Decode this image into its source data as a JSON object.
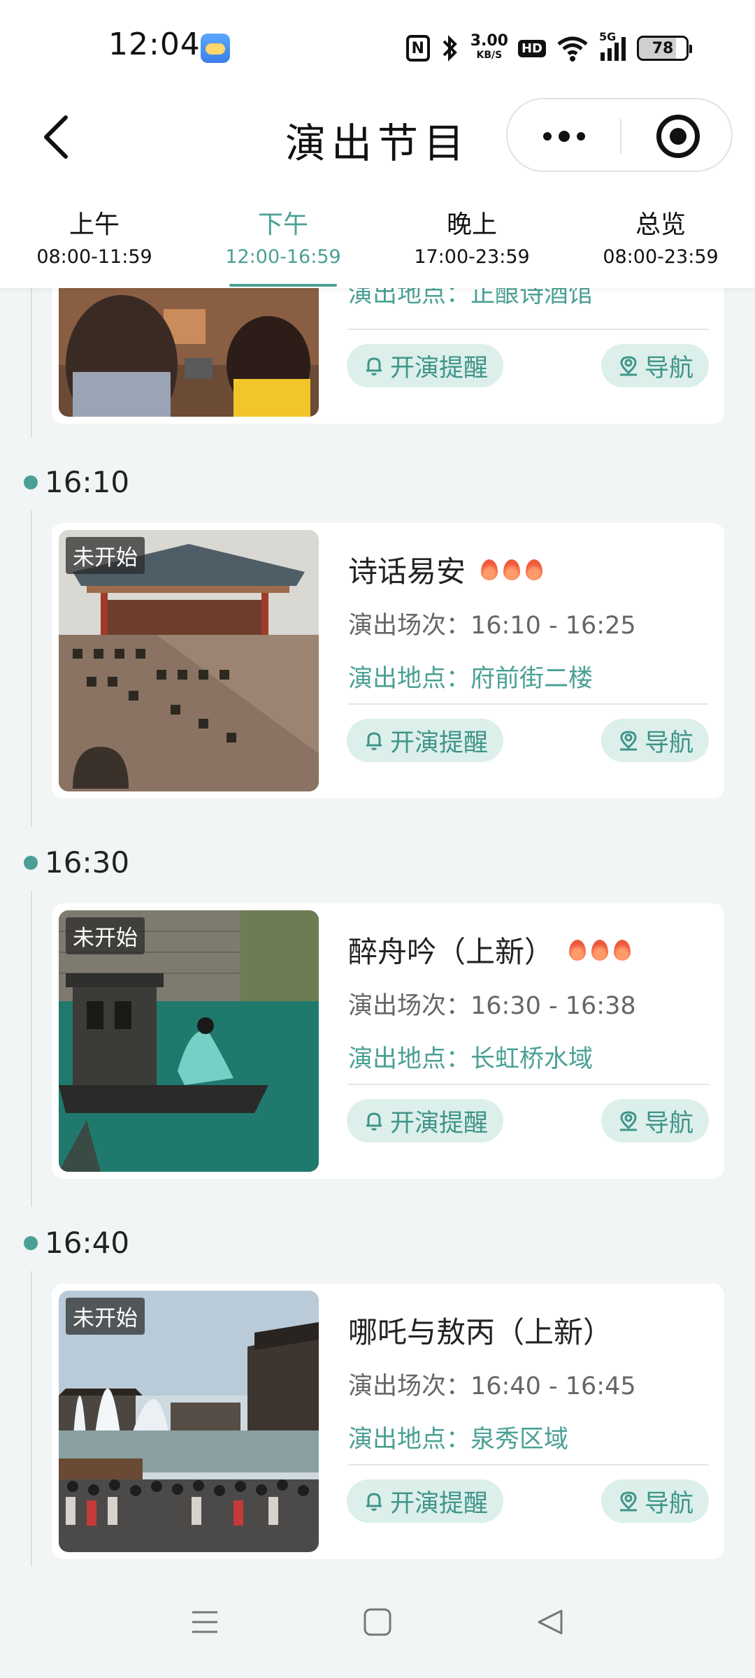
{
  "status_bar": {
    "time": "12:04",
    "net_speed_value": "3.00",
    "net_speed_unit": "KB/S",
    "hd_label": "HD",
    "signal_label": "5G",
    "battery": "78"
  },
  "header": {
    "title": "演出节目"
  },
  "tabs": [
    {
      "name": "上午",
      "time": "08:00-11:59"
    },
    {
      "name": "下午",
      "time": "12:00-16:59"
    },
    {
      "name": "晚上",
      "time": "17:00-23:59"
    },
    {
      "name": "总览",
      "time": "08:00-23:59"
    }
  ],
  "active_tab": 1,
  "colors": {
    "accent": "#4aa095",
    "pill_bg": "#dcefeb",
    "page_bg": "#f2f5f5",
    "flame": "#ef5a3e"
  },
  "partial_card": {
    "location_text": "演出地点：正酿诗酒馆",
    "remind_label": "开演提醒",
    "nav_label": "导航"
  },
  "groups": [
    {
      "time": "16:10",
      "status": "未开始",
      "title": "诗话易安",
      "heat": 3,
      "session": "演出场次：16:10 - 16:25",
      "location": "演出地点：府前街二楼",
      "remind_label": "开演提醒",
      "nav_label": "导航"
    },
    {
      "time": "16:30",
      "status": "未开始",
      "title": "醉舟吟（上新）",
      "heat": 3,
      "session": "演出场次：16:30 - 16:38",
      "location": "演出地点：长虹桥水域",
      "remind_label": "开演提醒",
      "nav_label": "导航"
    },
    {
      "time": "16:40",
      "status": "未开始",
      "title": "哪吒与敖丙（上新）",
      "heat": 0,
      "session": "演出场次：16:40 - 16:45",
      "location": "演出地点：泉秀区域",
      "remind_label": "开演提醒",
      "nav_label": "导航"
    }
  ]
}
